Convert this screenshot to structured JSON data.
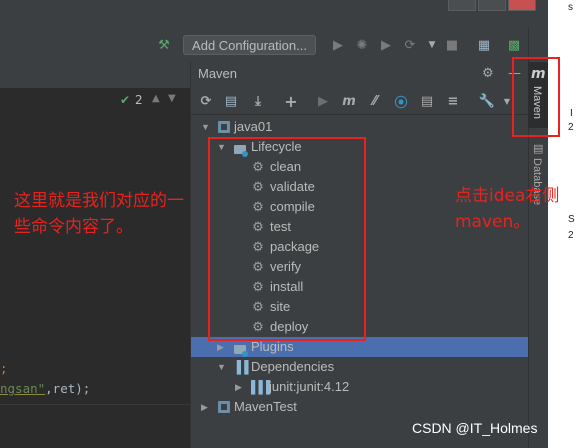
{
  "toolbar": {
    "add_config_label": "Add Configuration...",
    "icons": [
      "hammer-icon",
      "run-icon",
      "debug-icon",
      "coverage-icon",
      "profile-icon",
      "dropdown-icon",
      "stop-icon",
      "project-structure-icon",
      "terminal-icon",
      "search-icon"
    ]
  },
  "editor": {
    "inspection_count": "2",
    "code_line_1": ";",
    "code_line_2_str": "ngsan\"",
    "code_line_2_rest": ",ret);"
  },
  "maven_panel": {
    "title": "Maven",
    "tree": {
      "project": "java01",
      "lifecycle": "Lifecycle",
      "goals": [
        "clean",
        "validate",
        "compile",
        "test",
        "package",
        "verify",
        "install",
        "site",
        "deploy"
      ],
      "plugins": "Plugins",
      "dependencies": "Dependencies",
      "dependency_item": "junit:junit:4.12",
      "project2": "MavenTest"
    }
  },
  "right_strip": {
    "maven_tab": "Maven",
    "maven_tab_icon": "m",
    "database_tab": "Database"
  },
  "annotations": {
    "left_text": "这里就是我们对应的一些命令内容了。",
    "right_text": "点击idea右侧maven。",
    "watermark": "CSDN @IT_Holmes"
  },
  "edge": {
    "t1": "s",
    "t2": "I",
    "t3": "2",
    "t4": "S",
    "t5": "2"
  },
  "colors": {
    "annotation_red": "#e8231f",
    "selection_blue": "#4b6eaf",
    "panel_bg": "#3c3f41",
    "editor_bg": "#2b2b2b"
  }
}
